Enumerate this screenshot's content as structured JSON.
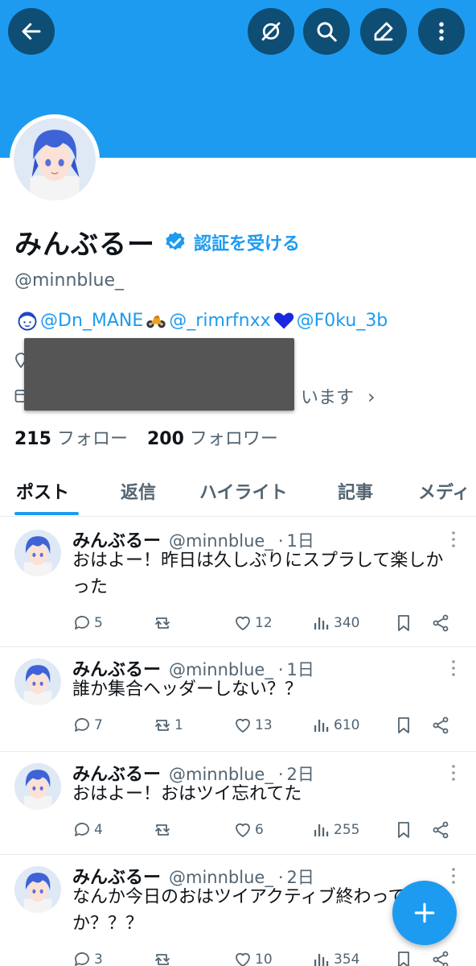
{
  "header": {
    "back_icon": "arrow-left-icon",
    "icons": [
      "eye-off-icon",
      "search-icon",
      "edit-icon",
      "more-vertical-icon"
    ],
    "banner_color": "#1d9bf0",
    "button_color": "#0e4d74"
  },
  "profile": {
    "display_name": "みんぶるー",
    "get_verified_label": "認証を受ける",
    "handle": "@minnblue_",
    "bio": {
      "mention1": "@Dn_MANE",
      "mention2": "@_rimrfnxx",
      "mention3": "@F0ku_3b"
    },
    "joined_text_partial": "います",
    "following_count": "215",
    "following_label": "フォロー",
    "followers_count": "200",
    "followers_label": "フォロワー"
  },
  "tabs": [
    "ポスト",
    "返信",
    "ハイライト",
    "記事",
    "メディ"
  ],
  "posts": [
    {
      "name": "みんぶるー",
      "handle": "@minnblue_",
      "time": "1日",
      "text": "おはよー！昨日は久しぶりにスプラして楽しかった",
      "replies": "5",
      "reposts": "",
      "likes": "12",
      "views": "340"
    },
    {
      "name": "みんぶるー",
      "handle": "@minnblue_",
      "time": "1日",
      "text": "誰か集合ヘッダーしない？？",
      "replies": "7",
      "reposts": "1",
      "likes": "13",
      "views": "610"
    },
    {
      "name": "みんぶるー",
      "handle": "@minnblue_",
      "time": "2日",
      "text": "おはよー！おはツイ忘れてた",
      "replies": "4",
      "reposts": "",
      "likes": "6",
      "views": "255"
    },
    {
      "name": "みんぶるー",
      "handle": "@minnblue_",
      "time": "2日",
      "text": "なんか今日のおはツイアクティブ終わってないか？？？",
      "replies": "3",
      "reposts": "",
      "likes": "10",
      "views": "354"
    }
  ],
  "colors": {
    "accent": "#1d9bf0",
    "muted": "#536471"
  }
}
